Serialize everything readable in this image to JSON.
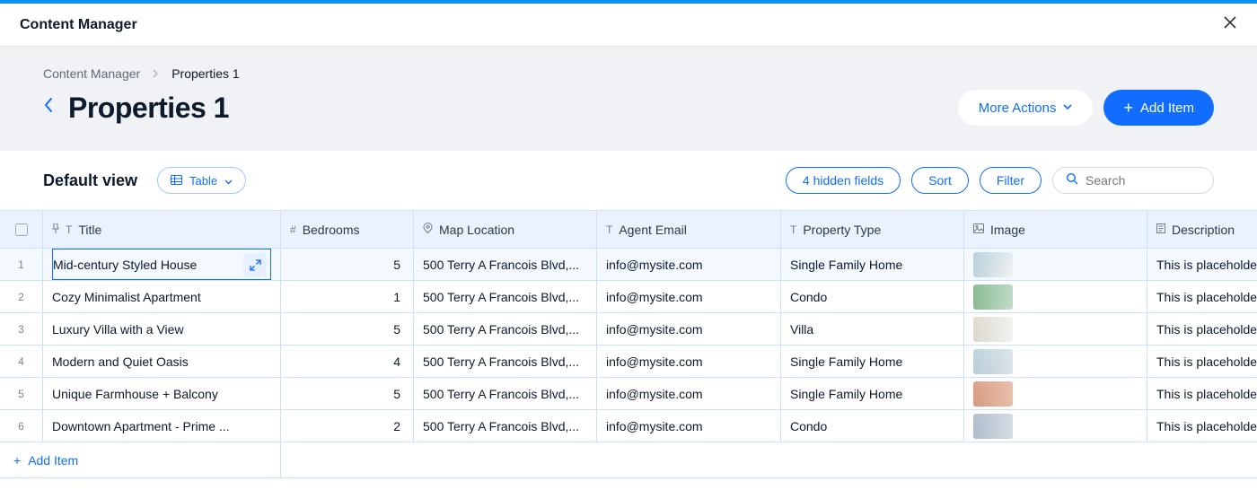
{
  "app_title": "Content Manager",
  "breadcrumb": {
    "root": "Content Manager",
    "current": "Properties 1"
  },
  "page_title": "Properties 1",
  "actions": {
    "more_label": "More Actions",
    "add_label": "Add Item"
  },
  "toolbar": {
    "view_name": "Default view",
    "view_type_label": "Table",
    "hidden_fields_label": "4 hidden fields",
    "sort_label": "Sort",
    "filter_label": "Filter",
    "search_placeholder": "Search"
  },
  "columns": {
    "title": "Title",
    "bedrooms": "Bedrooms",
    "map": "Map Location",
    "agent": "Agent Email",
    "ptype": "Property Type",
    "image": "Image",
    "desc": "Description"
  },
  "rows": [
    {
      "n": "1",
      "title": "Mid-century Styled House",
      "bedrooms": "5",
      "map": "500 Terry A Francois Blvd,...",
      "agent": "info@mysite.com",
      "ptype": "Single Family Home",
      "desc": "This is placeholde",
      "selected": true,
      "thumb": "t1"
    },
    {
      "n": "2",
      "title": "Cozy Minimalist Apartment",
      "bedrooms": "1",
      "map": "500 Terry A Francois Blvd,...",
      "agent": "info@mysite.com",
      "ptype": "Condo",
      "desc": "This is placeholde",
      "thumb": "t2"
    },
    {
      "n": "3",
      "title": "Luxury Villa with a View",
      "bedrooms": "5",
      "map": "500 Terry A Francois Blvd,...",
      "agent": "info@mysite.com",
      "ptype": "Villa",
      "desc": "This is placeholde",
      "thumb": "t3"
    },
    {
      "n": "4",
      "title": "Modern and Quiet Oasis",
      "bedrooms": "4",
      "map": "500 Terry A Francois Blvd,...",
      "agent": "info@mysite.com",
      "ptype": "Single Family Home",
      "desc": "This is placeholde",
      "thumb": "t4"
    },
    {
      "n": "5",
      "title": "Unique Farmhouse + Balcony",
      "bedrooms": "5",
      "map": "500 Terry A Francois Blvd,...",
      "agent": "info@mysite.com",
      "ptype": "Single Family Home",
      "desc": "This is placeholde",
      "thumb": "t5"
    },
    {
      "n": "6",
      "title": "Downtown Apartment - Prime ...",
      "bedrooms": "2",
      "map": "500 Terry A Francois Blvd,...",
      "agent": "info@mysite.com",
      "ptype": "Condo",
      "desc": "This is placeholde",
      "thumb": "t6"
    }
  ],
  "footer": {
    "add_item_label": "Add Item"
  }
}
